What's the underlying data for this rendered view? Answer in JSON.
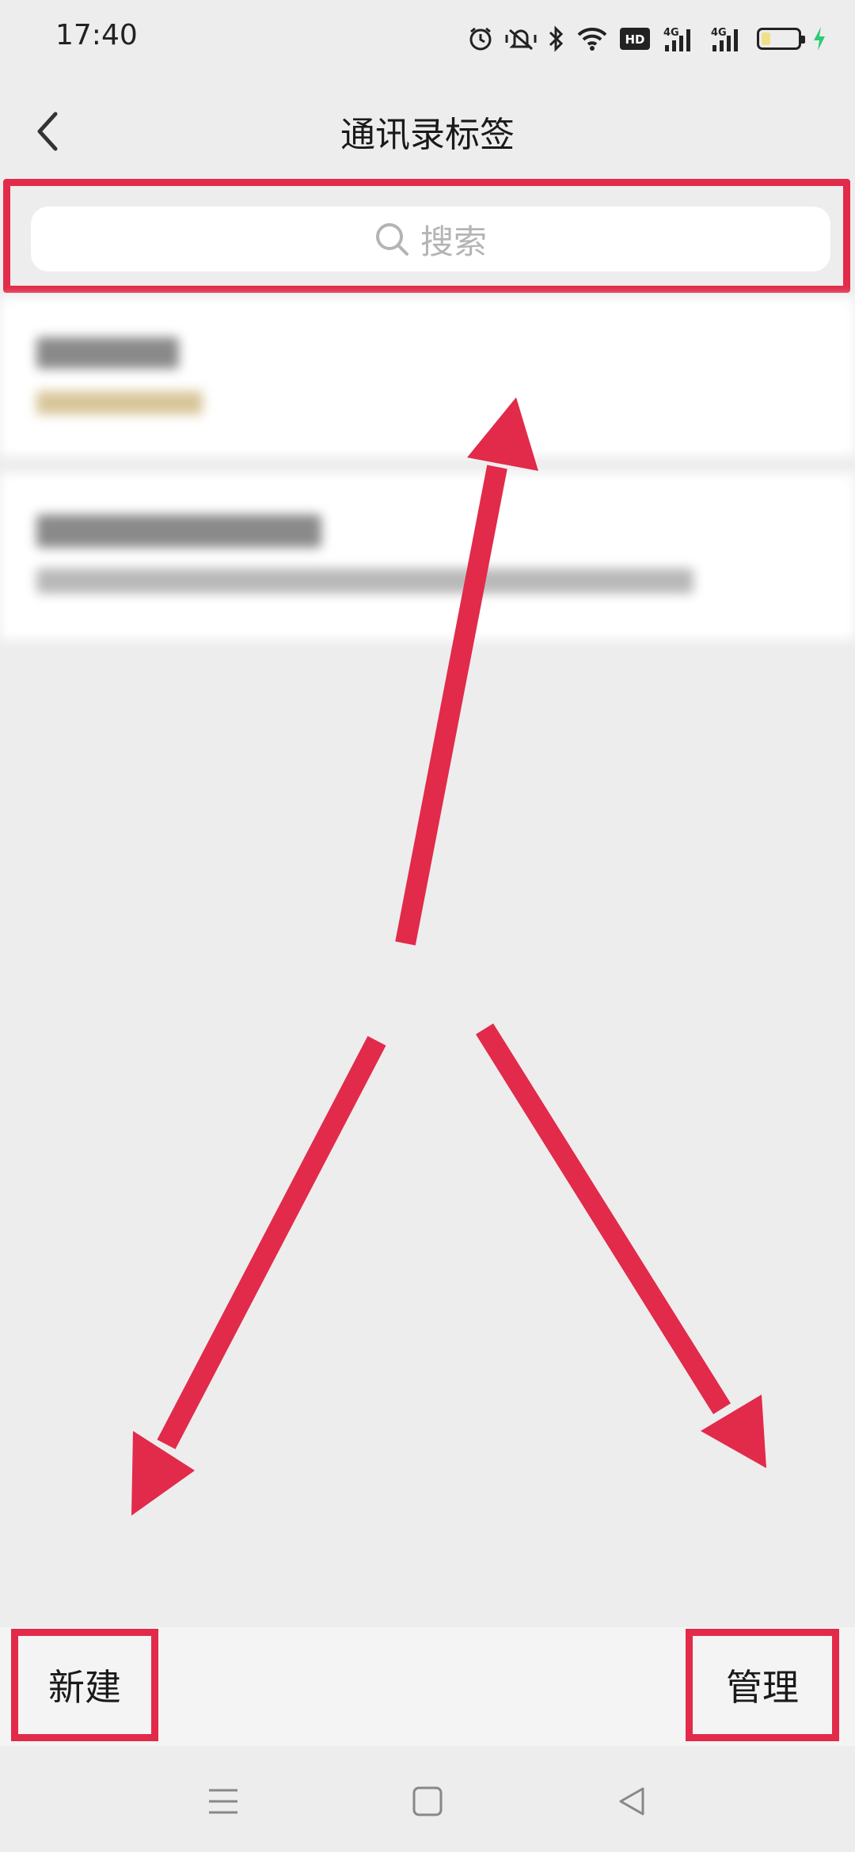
{
  "status_bar": {
    "time": "17:40",
    "icons": [
      "alarm-icon",
      "vibrate-icon",
      "bluetooth-icon",
      "wifi-icon",
      "hd-icon",
      "signal-4g-icon",
      "signal-4g-icon",
      "battery-icon",
      "charging-icon"
    ],
    "hd_label": "HD",
    "network_label_1": "4G",
    "network_label_2": "4G",
    "battery_level": 0.25,
    "charging_color": "#2ecc71"
  },
  "header": {
    "title": "通讯录标签",
    "back_icon": "chevron-left-icon"
  },
  "search": {
    "placeholder": "搜索",
    "icon": "search-icon"
  },
  "footer": {
    "new_label": "新建",
    "manage_label": "管理"
  },
  "nav_bar": {
    "icons": [
      "menu-icon",
      "home-icon",
      "back-triangle-icon"
    ]
  },
  "colors": {
    "highlight": "#e22a4a",
    "background": "#ededed",
    "card": "#ffffff"
  }
}
